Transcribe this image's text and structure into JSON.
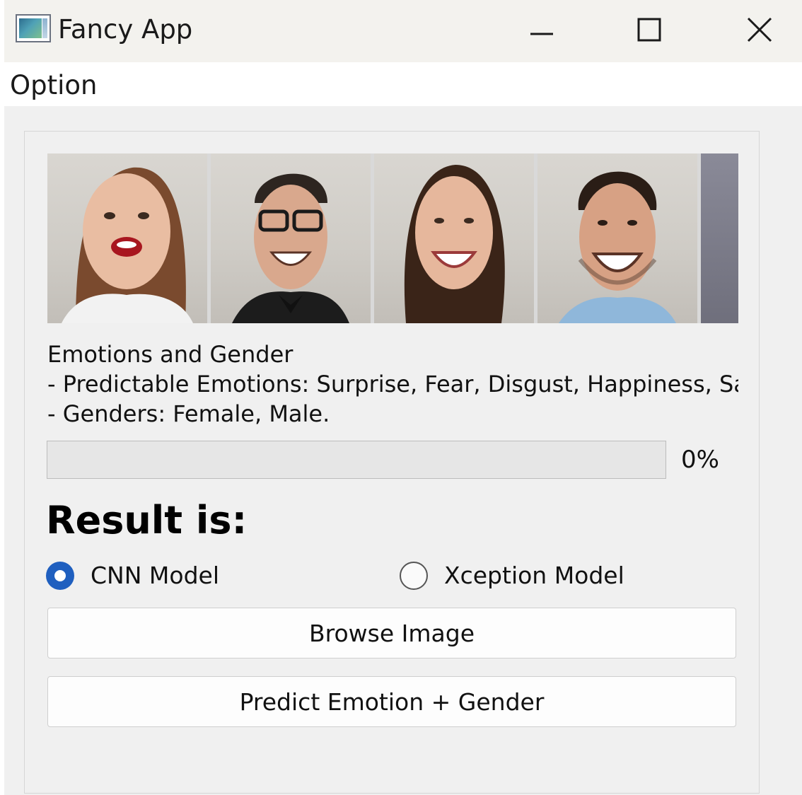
{
  "window": {
    "title": "Fancy App",
    "icons": {
      "app": "app-window-icon",
      "minimize": "minimize-icon",
      "maximize": "maximize-icon",
      "close": "close-icon"
    }
  },
  "menu": {
    "items": [
      "Option"
    ]
  },
  "banner": {
    "image": "collage of five smiling faces"
  },
  "description": {
    "heading": "Emotions and Gender",
    "emotions_line": "- Predictable Emotions: Surprise, Fear, Disgust, Happiness, Sa",
    "genders_line": "- Genders: Female, Male."
  },
  "progress": {
    "value_percent": 0,
    "label": "0%",
    "fill_color": "#06b025"
  },
  "result": {
    "label": "Result is:"
  },
  "models": {
    "options": [
      {
        "label": "CNN Model",
        "selected": true
      },
      {
        "label": "Xception Model",
        "selected": false
      }
    ],
    "accent_color": "#1f5fbf"
  },
  "buttons": {
    "browse": "Browse Image",
    "predict": "Predict Emotion + Gender"
  }
}
